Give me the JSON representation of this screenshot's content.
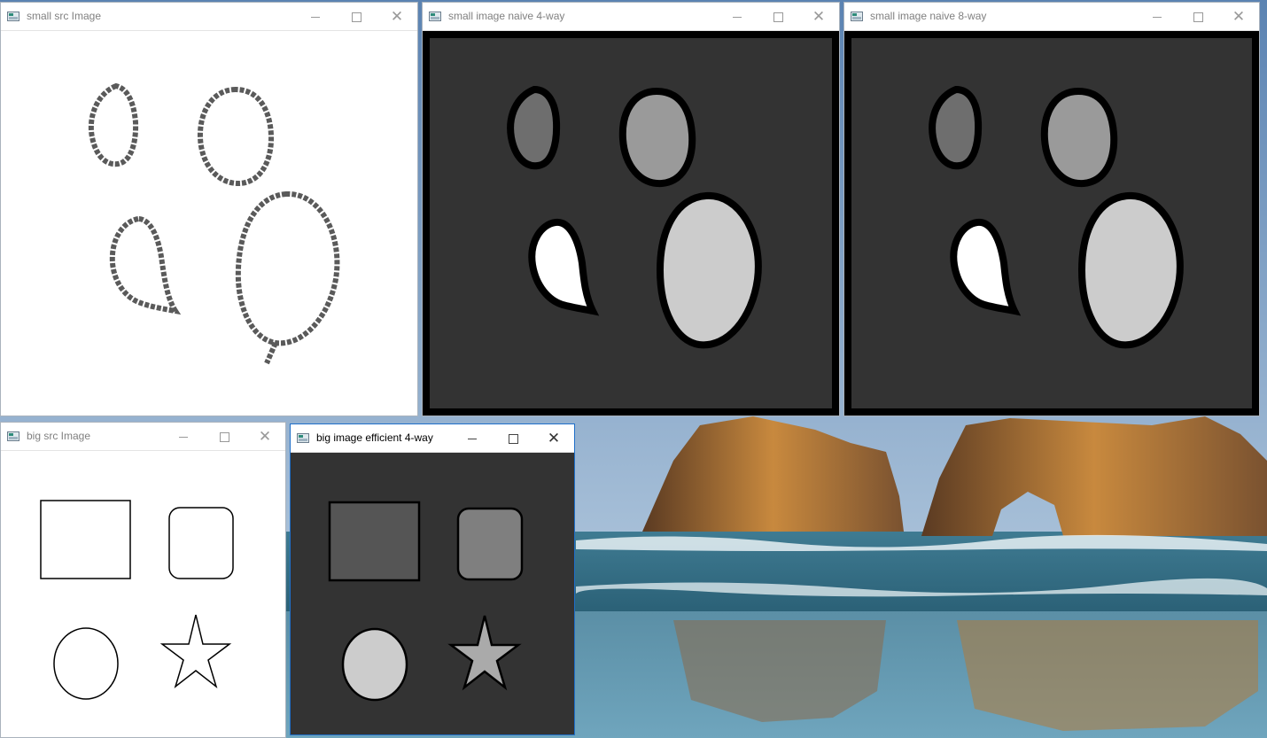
{
  "windows": {
    "small_src": {
      "title": "small src Image"
    },
    "naive4": {
      "title": "small image naive 4-way"
    },
    "naive8": {
      "title": "small image naive 8-way"
    },
    "big_src": {
      "title": "big src Image"
    },
    "efficient4": {
      "title": "big image efficient 4-way"
    }
  },
  "colors": {
    "label_background": "#333333",
    "region_dark": "#555555",
    "region_mid": "#7f7f7f",
    "region_light": "#cccccc",
    "region_white": "#ffffff",
    "region_small_a": "#6e6e6e",
    "region_small_b": "#9a9a9a",
    "boundary": "#000000"
  },
  "icons": {
    "app": "app-window-icon",
    "minimize": "minimize-icon",
    "maximize": "maximize-icon",
    "close": "close-icon"
  }
}
